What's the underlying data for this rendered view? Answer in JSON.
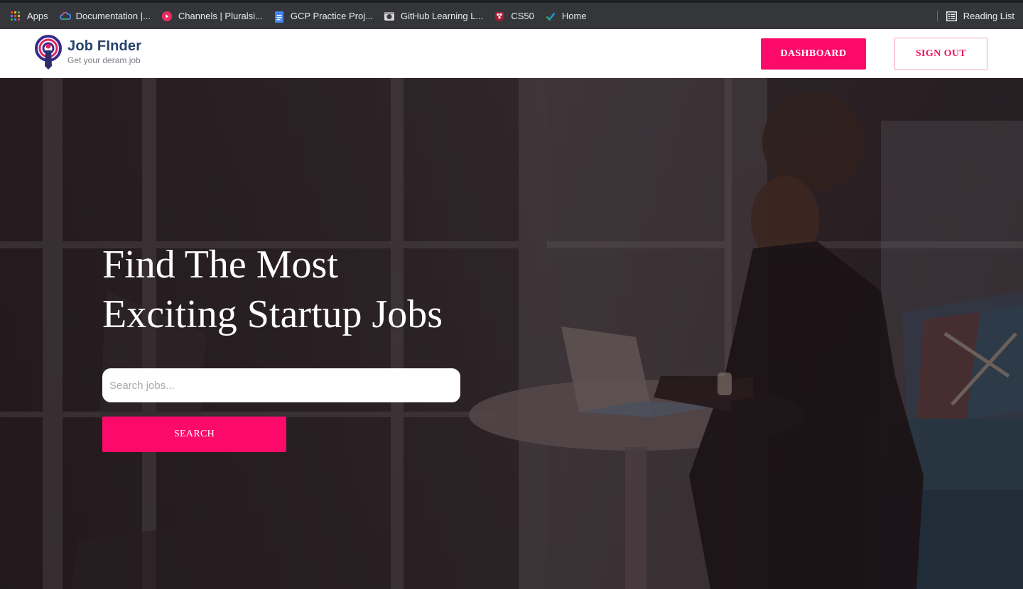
{
  "bookmarks": {
    "items": [
      {
        "label": "Apps",
        "icon": "apps-grid-icon"
      },
      {
        "label": "Documentation  |...",
        "icon": "cloud-icon"
      },
      {
        "label": "Channels | Pluralsi...",
        "icon": "pluralsight-icon"
      },
      {
        "label": "GCP Practice Proj...",
        "icon": "docs-icon"
      },
      {
        "label": "GitHub Learning L...",
        "icon": "github-icon"
      },
      {
        "label": "CS50",
        "icon": "harvard-icon"
      },
      {
        "label": "Home",
        "icon": "check-icon"
      }
    ],
    "reading_list": "Reading List"
  },
  "navbar": {
    "logo_title": "Job FInder",
    "logo_tagline": "Get your deram job",
    "dashboard_label": "DASHBOARD",
    "signout_label": "SIGN OUT"
  },
  "hero": {
    "title_line1": "Find The Most",
    "title_line2": "Exciting Startup Jobs",
    "search_placeholder": "Search jobs...",
    "search_button": "SEARCH"
  },
  "colors": {
    "accent": "#fb0a6a",
    "brand_blue": "#24416b",
    "bookmark_bar": "#35363a"
  }
}
